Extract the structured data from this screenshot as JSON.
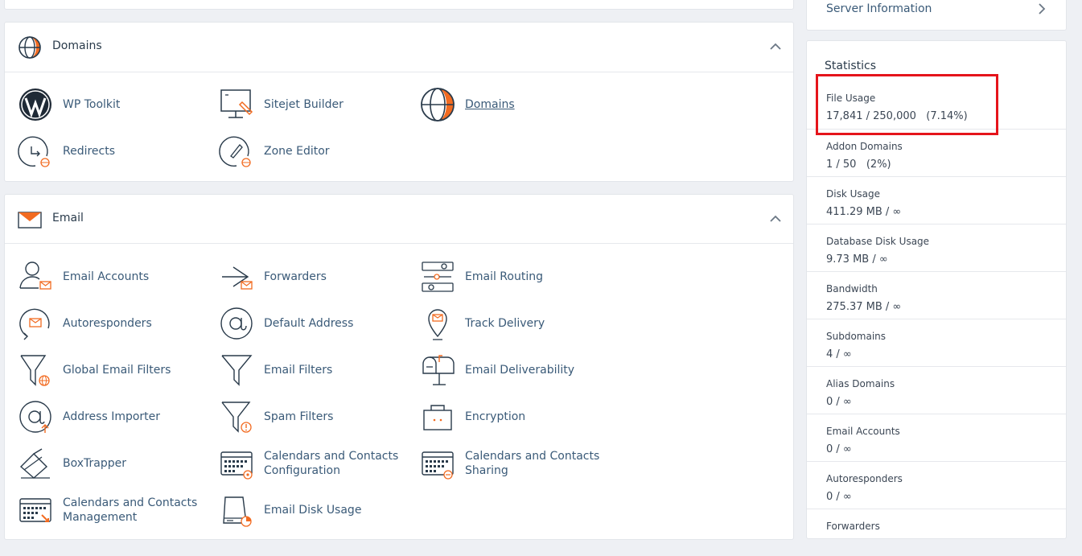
{
  "domains": {
    "title": "Domains",
    "tools": [
      {
        "label": "WP Toolkit",
        "icon": "wordpress-icon"
      },
      {
        "label": "Sitejet Builder",
        "icon": "sitejet-icon"
      },
      {
        "label": "Domains",
        "icon": "globe-icon"
      },
      {
        "label": "Redirects",
        "icon": "redirect-icon"
      },
      {
        "label": "Zone Editor",
        "icon": "zone-editor-icon"
      }
    ]
  },
  "email": {
    "title": "Email",
    "tools": [
      {
        "label": "Email Accounts",
        "icon": "email-accounts-icon"
      },
      {
        "label": "Forwarders",
        "icon": "forwarders-icon"
      },
      {
        "label": "Email Routing",
        "icon": "email-routing-icon"
      },
      {
        "label": "Autoresponders",
        "icon": "autoresponders-icon"
      },
      {
        "label": "Default Address",
        "icon": "at-sign-icon"
      },
      {
        "label": "Track Delivery",
        "icon": "track-delivery-icon"
      },
      {
        "label": "Global Email Filters",
        "icon": "global-filter-icon"
      },
      {
        "label": "Email Filters",
        "icon": "filter-icon"
      },
      {
        "label": "Email Deliverability",
        "icon": "mailbox-icon"
      },
      {
        "label": "Address Importer",
        "icon": "address-importer-icon"
      },
      {
        "label": "Spam Filters",
        "icon": "spam-filter-icon"
      },
      {
        "label": "Encryption",
        "icon": "encryption-icon"
      },
      {
        "label": "BoxTrapper",
        "icon": "boxtrapper-icon"
      },
      {
        "label": "Calendars and Contacts Configuration",
        "icon": "calendar-config-icon"
      },
      {
        "label": "Calendars and Contacts Sharing",
        "icon": "calendar-sharing-icon"
      },
      {
        "label": "Calendars and Contacts Management",
        "icon": "calendar-management-icon"
      },
      {
        "label": "Email Disk Usage",
        "icon": "email-disk-usage-icon"
      }
    ]
  },
  "sidebar": {
    "server_info": "Server Information",
    "stats_title": "Statistics",
    "stats": [
      {
        "label": "File Usage",
        "value": "17,841 / 250,000   (7.14%)"
      },
      {
        "label": "Addon Domains",
        "value": "1 / 50   (2%)"
      },
      {
        "label": "Disk Usage",
        "value": "411.29 MB / ∞"
      },
      {
        "label": "Database Disk Usage",
        "value": "9.73 MB / ∞"
      },
      {
        "label": "Bandwidth",
        "value": "275.37 MB / ∞"
      },
      {
        "label": "Subdomains",
        "value": "4 / ∞"
      },
      {
        "label": "Alias Domains",
        "value": "0 / ∞"
      },
      {
        "label": "Email Accounts",
        "value": "0 / ∞"
      },
      {
        "label": "Autoresponders",
        "value": "0 / ∞"
      },
      {
        "label": "Forwarders",
        "value": ""
      }
    ]
  },
  "colors": {
    "accent": "#f26b21",
    "highlight": "#e5141b",
    "link": "#3a5a78"
  }
}
